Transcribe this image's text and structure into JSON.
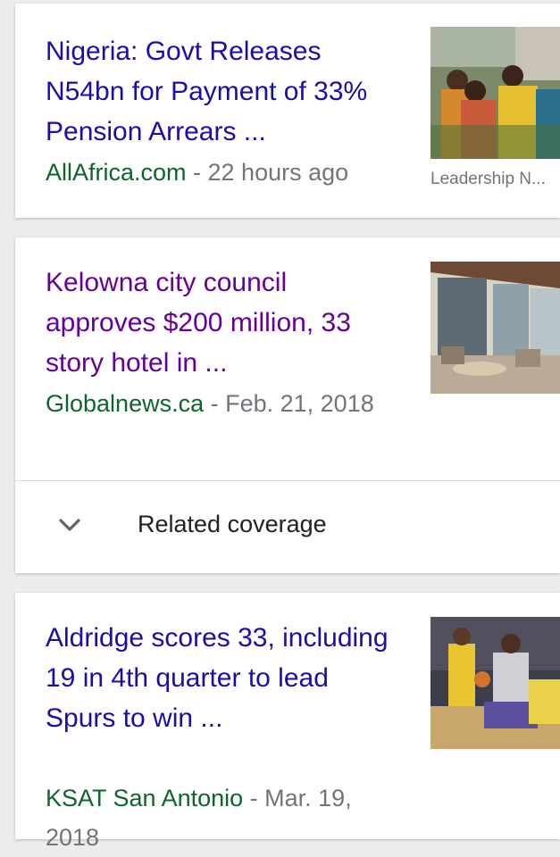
{
  "articles": [
    {
      "headline": "Nigeria: Govt Releases N54bn for Payment of 33% Pension Arrears ...",
      "source": "AllAfrica.com",
      "time": " - 22 hours ago",
      "thumbnail_caption": "Leadership N...",
      "thumbnail_icon": "news-photo-crowd"
    },
    {
      "headline": "Kelowna city council approves $200 million, 33 story hotel in ...",
      "source": "Globalnews.ca",
      "time": " - Feb. 21, 2018",
      "thumbnail_icon": "news-photo-hotel-interior",
      "related_label": "Related coverage"
    },
    {
      "headline": "Aldridge scores 33, including 19 in 4th quarter to lead Spurs to win ...",
      "source": "KSAT San Antonio",
      "time": " - Mar. 19, 2018",
      "thumbnail_icon": "news-photo-basketball"
    }
  ],
  "colors": {
    "headline_link": "#1a0dab",
    "headline_visited": "#660099",
    "source": "#0d652d",
    "meta": "#70757a",
    "background": "#ececec"
  }
}
